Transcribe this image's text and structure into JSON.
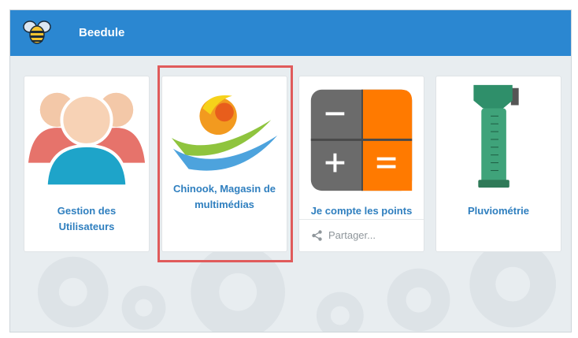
{
  "app": {
    "title": "Beedule",
    "logo_icon": "bee-icon"
  },
  "cards": [
    {
      "id": "gestion",
      "label_line1": "Gestion des",
      "label_line2": "Utilisateurs",
      "icon": "users-icon"
    },
    {
      "id": "chinook",
      "label_line1": "Chinook, Magasin de",
      "label_line2": "multimédias",
      "icon": "chinook-logo-icon",
      "highlighted": true
    },
    {
      "id": "points",
      "label": "Je compte les points",
      "icon": "calculator-icon",
      "share_label": "Partager...",
      "share_icon": "share-icon"
    },
    {
      "id": "pluvio",
      "label": "Pluviométrie",
      "icon": "rain-gauge-icon"
    }
  ],
  "colors": {
    "topbar": "#2b87d1",
    "card_label": "#2f7fbf",
    "highlight": "#e05b5b"
  }
}
